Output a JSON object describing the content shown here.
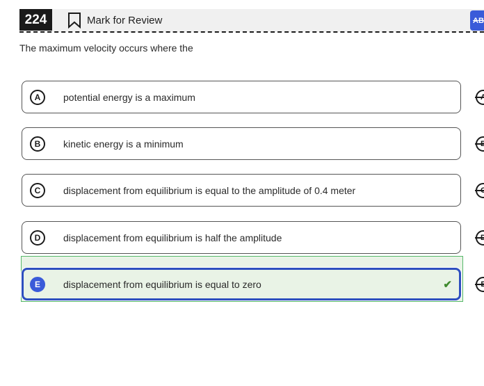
{
  "header": {
    "question_number": "224",
    "mark_label": "Mark for Review",
    "abc_label": "ABC"
  },
  "question": {
    "text": "The maximum velocity occurs where the"
  },
  "choices": [
    {
      "letter": "A",
      "text": "potential energy is a maximum",
      "selected": false
    },
    {
      "letter": "B",
      "text": "kinetic energy is a minimum",
      "selected": false
    },
    {
      "letter": "C",
      "text": "displacement from equilibrium is equal to the amplitude of 0.4 meter",
      "selected": false
    },
    {
      "letter": "D",
      "text": "displacement from equilibrium is half the amplitude",
      "selected": false
    },
    {
      "letter": "E",
      "text": "displacement from equilibrium is equal to zero",
      "selected": true
    }
  ],
  "colors": {
    "accent": "#3a5bd9",
    "selected_bg": "#e9f3e6",
    "correct_green": "#3f8a2e"
  },
  "icons": {
    "bookmark": "bookmark-icon",
    "check": "check-icon",
    "strike": "strikethrough-icon"
  }
}
